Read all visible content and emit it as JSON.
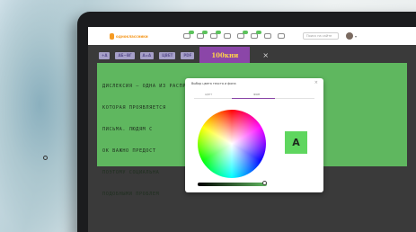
{
  "topbar": {
    "logo_text": "одноклассники",
    "search_placeholder": "Поиск на сайте",
    "nav_icons": [
      "messages-icon",
      "discussions-icon",
      "notifications-icon",
      "guests-icon",
      "events-icon",
      "friends-icon",
      "video-icon",
      "music-icon"
    ]
  },
  "toolbar": {
    "buttons": [
      {
        "label": "+A",
        "icon": "font-size-increase"
      },
      {
        "label": "АБ~ВГ",
        "icon": "letter-spacing"
      },
      {
        "label": "A=A",
        "icon": "line-height"
      },
      {
        "label": "ЦВЕТ",
        "icon": "color"
      },
      {
        "label": "PDF",
        "icon": "pdf"
      }
    ],
    "ad_text": "100кни",
    "close_glyph": "×"
  },
  "content": {
    "lines": [
      "ДИСЛЕКСИЯ — ОДНА ИЗ РАСПРОСТРАНЕННЫХ ПРОБЛЕМ ОБУЧЕНИЯ ДЕТЕЙ,",
      "КОТОРАЯ ПРОЯВЛЯЕТСЯ                         ЧТЕНИЯ И",
      "ПИСЬМА. ЛЮДЯМ С                            ТЯЖЕЛО УЧИТЬСЯ.",
      "ОК ВАЖНО ПРЕДОСТ                         ЫЕ ВОЗМОЖНОСТИ,",
      "ПОЭТОМУ СОЦИАЛЬНА                        СТАЛКИВАЕТСЯ С",
      "ПОДОБНЫМИ ПРОБЛЕМ"
    ]
  },
  "dialog": {
    "title": "Выбор цвета текста и фона",
    "close_glyph": "×",
    "tabs": [
      "ЦВЕТ",
      "ФОН"
    ],
    "active_tab": "ФОН",
    "preview_letter": "A",
    "preview_color": "#5fd65f",
    "slider_value": 1.0
  },
  "colors": {
    "accent": "#8b46a8",
    "panel_bg": "#5fb75f",
    "toolbar_btn": "#a6a0c8",
    "logo": "#f59a23"
  }
}
